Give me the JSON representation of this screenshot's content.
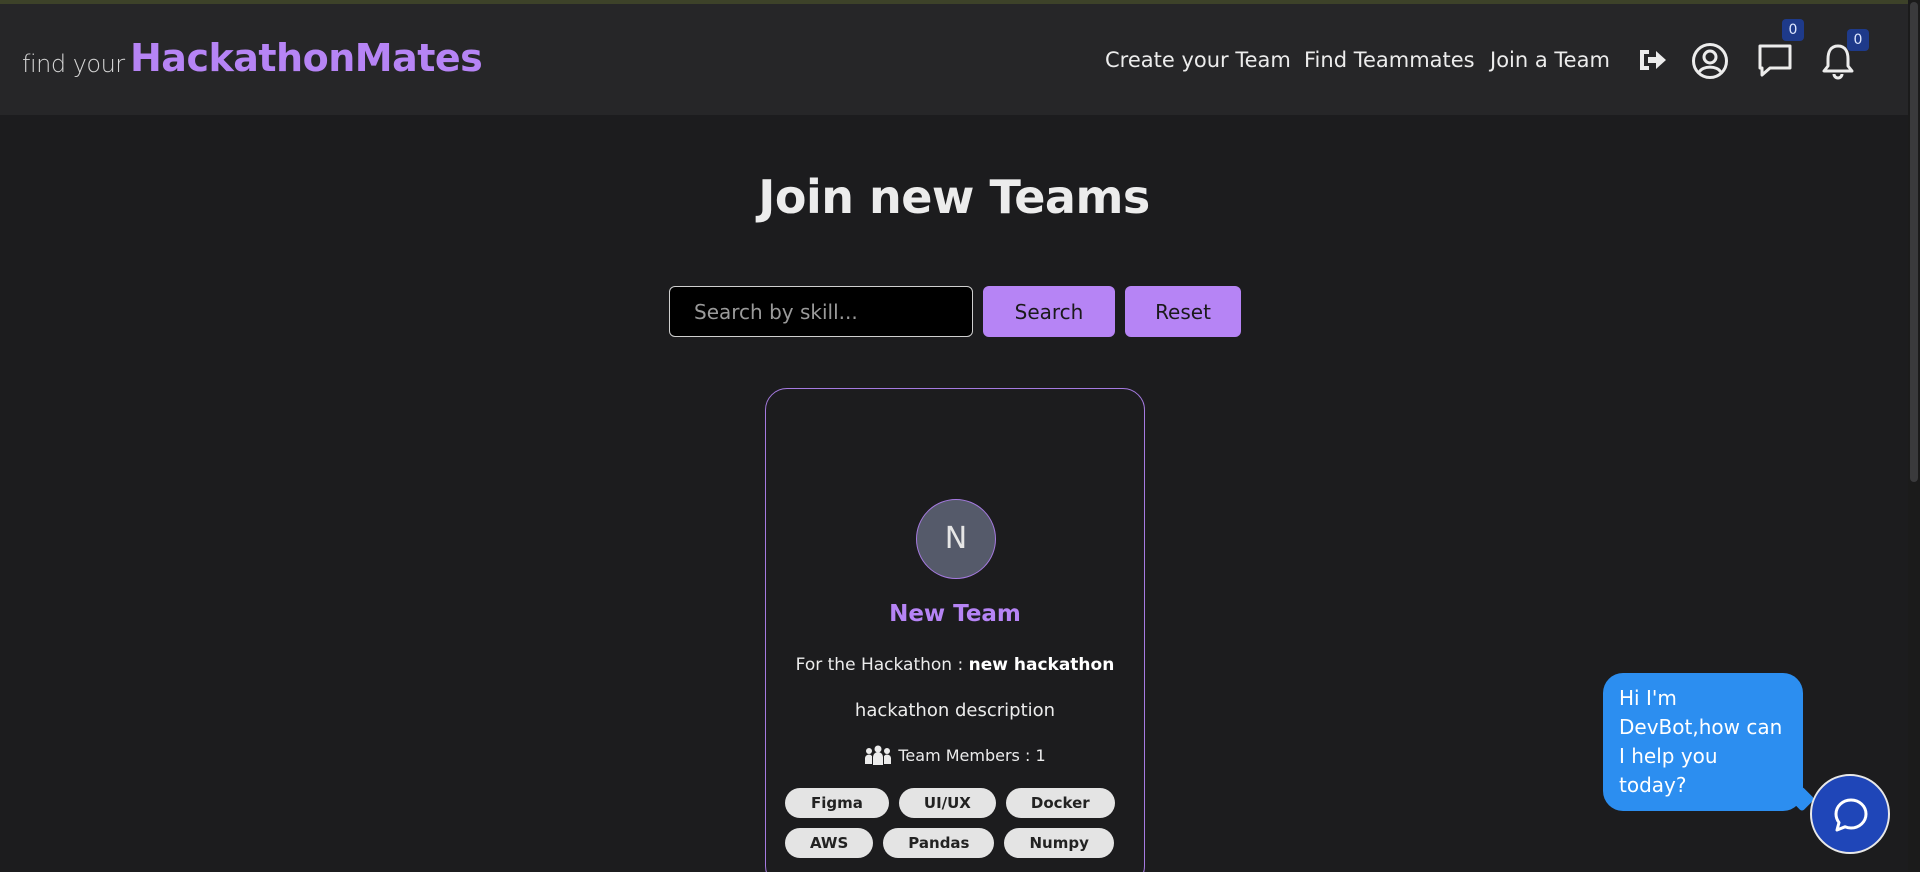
{
  "brand": {
    "prefix": "find your",
    "name": "HackathonMates"
  },
  "nav": {
    "links": [
      "Create your Team",
      "Find Teammates",
      "Join a Team"
    ],
    "icons": [
      "logout-icon",
      "user-icon",
      "message-icon",
      "bell-icon"
    ],
    "message_count": "0",
    "notification_count": "0"
  },
  "main": {
    "title": "Join new Teams",
    "search_placeholder": "Search by skill...",
    "search_label": "Search",
    "reset_label": "Reset"
  },
  "team_card": {
    "avatar_letter": "N",
    "name": "New Team",
    "hackathon_prefix": "For the Hackathon : ",
    "hackathon_name": "new hackathon",
    "description": "hackathon description",
    "members_label": "Team Members :  1",
    "skills": [
      "Figma",
      "UI/UX",
      "Docker",
      "AWS",
      "Pandas",
      "Numpy"
    ]
  },
  "chatbot": {
    "greeting": "Hi I'm DevBot,how can I help you today?"
  },
  "colors": {
    "accent": "#b684f5",
    "background": "#1c1c1e",
    "navbar": "#262628",
    "chat_bubble": "#2c8ef0",
    "chat_button": "#1f46b8",
    "badge": "#1e3a8a"
  }
}
